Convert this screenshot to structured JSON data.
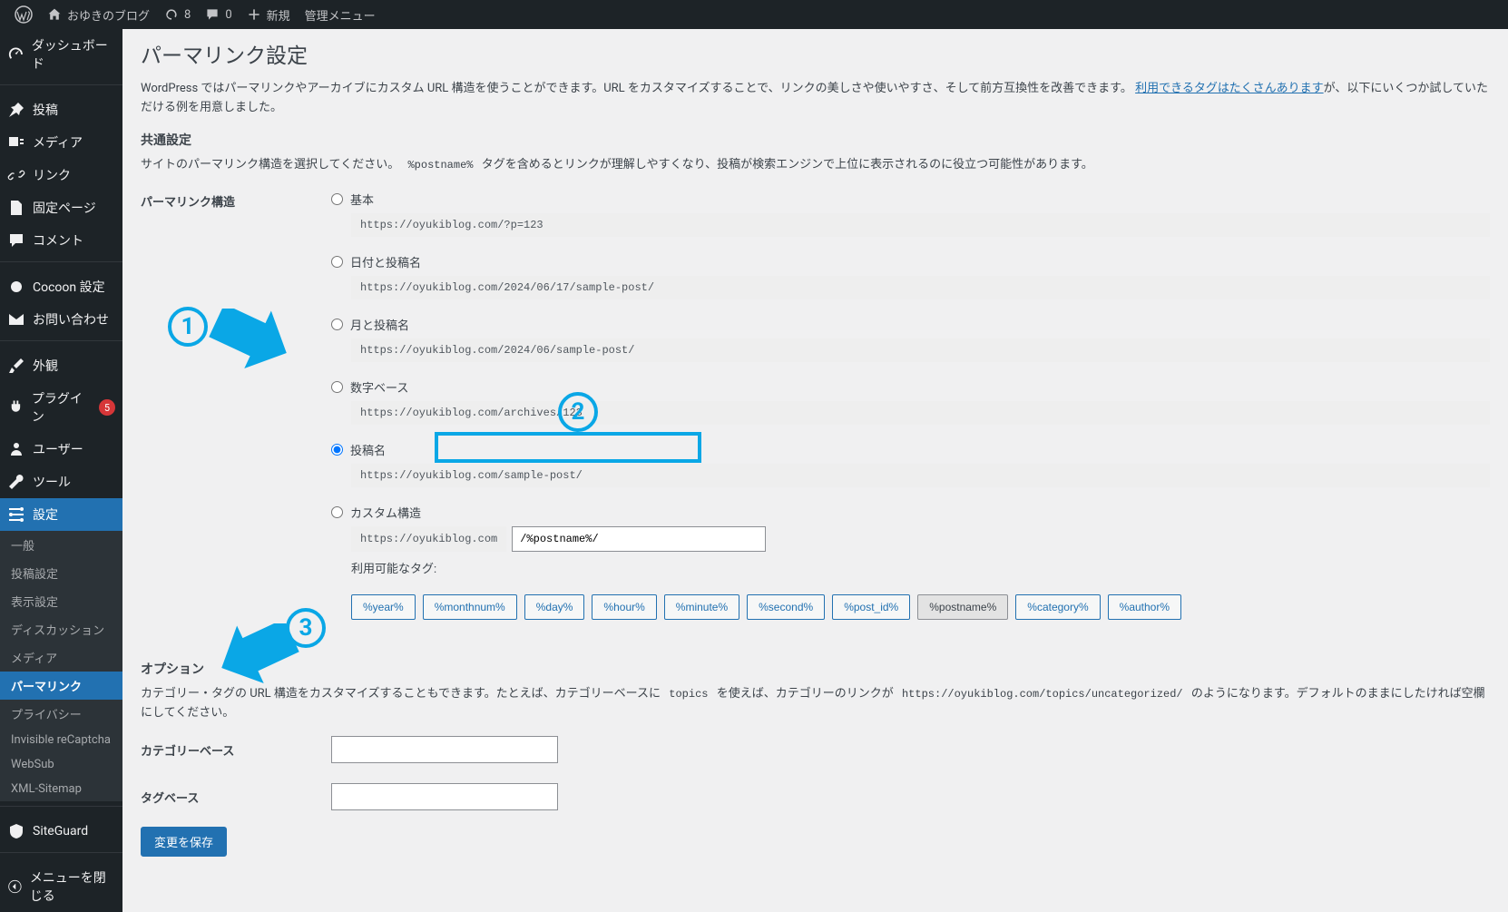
{
  "topbar": {
    "site_name": "おゆきのブログ",
    "updates_count": "8",
    "comments_count": "0",
    "new_label": "新規",
    "admin_menu_label": "管理メニュー"
  },
  "sidebar": {
    "items": [
      {
        "label": "ダッシュボード",
        "icon": "dashboard"
      },
      {
        "label": "投稿",
        "icon": "pin"
      },
      {
        "label": "メディア",
        "icon": "media"
      },
      {
        "label": "リンク",
        "icon": "link"
      },
      {
        "label": "固定ページ",
        "icon": "page"
      },
      {
        "label": "コメント",
        "icon": "comment"
      },
      {
        "label": "Cocoon 設定",
        "icon": "cocoon"
      },
      {
        "label": "お問い合わせ",
        "icon": "mail"
      },
      {
        "label": "外観",
        "icon": "appearance"
      },
      {
        "label": "プラグイン",
        "icon": "plugin",
        "badge": "5"
      },
      {
        "label": "ユーザー",
        "icon": "user"
      },
      {
        "label": "ツール",
        "icon": "tools"
      },
      {
        "label": "設定",
        "icon": "settings",
        "current": true
      }
    ],
    "sub": [
      {
        "label": "一般"
      },
      {
        "label": "投稿設定"
      },
      {
        "label": "表示設定"
      },
      {
        "label": "ディスカッション"
      },
      {
        "label": "メディア"
      },
      {
        "label": "パーマリンク",
        "current": true
      },
      {
        "label": "プライバシー"
      },
      {
        "label": "Invisible reCaptcha"
      },
      {
        "label": "WebSub"
      },
      {
        "label": "XML-Sitemap"
      }
    ],
    "siteguard": {
      "label": "SiteGuard",
      "icon": "shield"
    },
    "collapse": {
      "label": "メニューを閉じる"
    }
  },
  "page": {
    "title": "パーマリンク設定",
    "intro_a": "WordPress ではパーマリンクやアーカイブにカスタム URL 構造を使うことができます。URL をカスタマイズすることで、リンクの美しさや使いやすさ、そして前方互換性を改善できます。",
    "intro_link": "利用できるタグはたくさんあります",
    "intro_b": "が、以下にいくつか試していただける例を用意しました。",
    "common_heading": "共通設定",
    "common_desc_a": "サイトのパーマリンク構造を選択してください。",
    "postname_code": "%postname%",
    "common_desc_b": "タグを含めるとリンクが理解しやすくなり、投稿が検索エンジンで上位に表示されるのに役立つ可能性があります。",
    "structure_label": "パーマリンク構造",
    "options": [
      {
        "label": "基本",
        "url": "https://oyukiblog.com/?p=123"
      },
      {
        "label": "日付と投稿名",
        "url": "https://oyukiblog.com/2024/06/17/sample-post/"
      },
      {
        "label": "月と投稿名",
        "url": "https://oyukiblog.com/2024/06/sample-post/"
      },
      {
        "label": "数字ベース",
        "url": "https://oyukiblog.com/archives/123"
      },
      {
        "label": "投稿名",
        "url": "https://oyukiblog.com/sample-post/",
        "checked": true
      },
      {
        "label": "カスタム構造"
      }
    ],
    "custom_prefix": "https://oyukiblog.com",
    "custom_value": "/%postname%/",
    "tags_label": "利用可能なタグ:",
    "tags": [
      "%year%",
      "%monthnum%",
      "%day%",
      "%hour%",
      "%minute%",
      "%second%",
      "%post_id%",
      "%postname%",
      "%category%",
      "%author%"
    ],
    "active_tag": "%postname%",
    "option_heading": "オプション",
    "option_desc_a": "カテゴリー・タグの URL 構造をカスタマイズすることもできます。たとえば、カテゴリーベースに",
    "option_code_a": "topics",
    "option_desc_b": "を使えば、カテゴリーのリンクが",
    "option_code_b": "https://oyukiblog.com/topics/uncategorized/",
    "option_desc_c": "のようになります。デフォルトのままにしたければ空欄にしてください。",
    "cat_base_label": "カテゴリーベース",
    "tag_base_label": "タグベース",
    "submit_label": "変更を保存"
  },
  "annotations": {
    "n1": "1",
    "n2": "2",
    "n3": "3"
  }
}
